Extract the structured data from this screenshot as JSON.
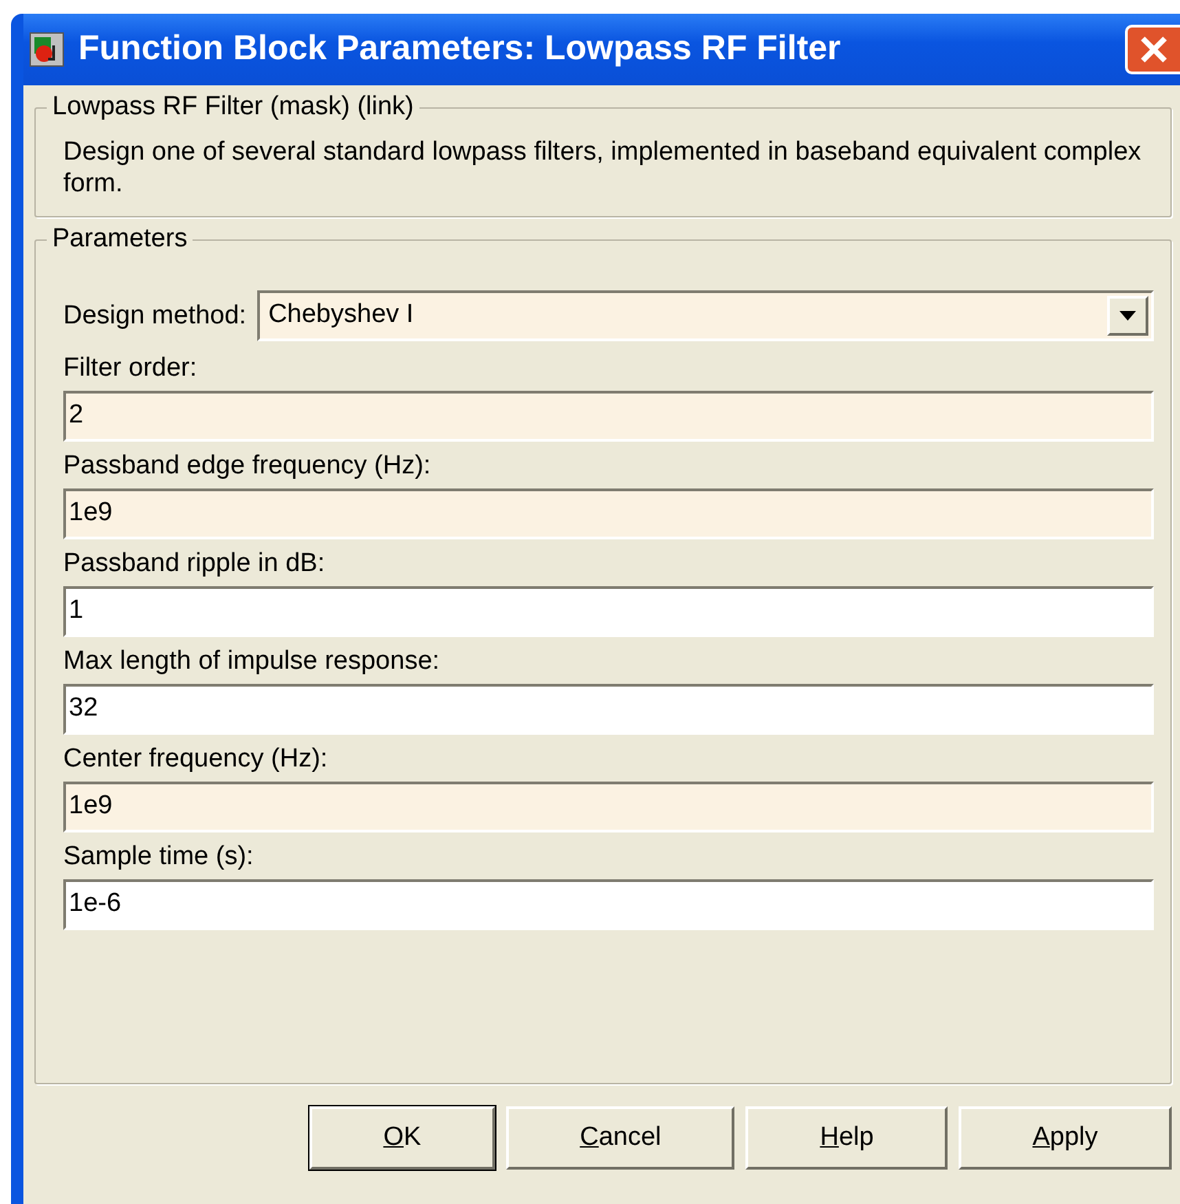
{
  "window": {
    "title": "Function Block Parameters: Lowpass RF Filter"
  },
  "description_group": {
    "title": "Lowpass RF Filter (mask) (link)",
    "text": "Design one of several standard lowpass filters, implemented in baseband equivalent complex form."
  },
  "parameters_group": {
    "title": "Parameters",
    "fields": [
      {
        "kind": "dropdown",
        "label": "Design method:",
        "value": "Chebyshev I",
        "tinted": true
      },
      {
        "kind": "text",
        "label": "Filter order:",
        "value": "2",
        "tinted": true
      },
      {
        "kind": "text",
        "label": "Passband edge frequency (Hz):",
        "value": "1e9",
        "tinted": true
      },
      {
        "kind": "text",
        "label": "Passband ripple in dB:",
        "value": "1",
        "tinted": false
      },
      {
        "kind": "text",
        "label": "Max length of impulse response:",
        "value": "32",
        "tinted": false
      },
      {
        "kind": "text",
        "label": "Center frequency (Hz):",
        "value": "1e9",
        "tinted": true
      },
      {
        "kind": "text",
        "label": "Sample time (s):",
        "value": "1e-6",
        "tinted": false
      }
    ]
  },
  "buttons": [
    {
      "key": "O",
      "rest": "K",
      "default": true
    },
    {
      "key": "C",
      "rest": "ancel",
      "default": false
    },
    {
      "key": "H",
      "rest": "elp",
      "default": false
    },
    {
      "key": "A",
      "rest": "pply",
      "default": false
    }
  ]
}
